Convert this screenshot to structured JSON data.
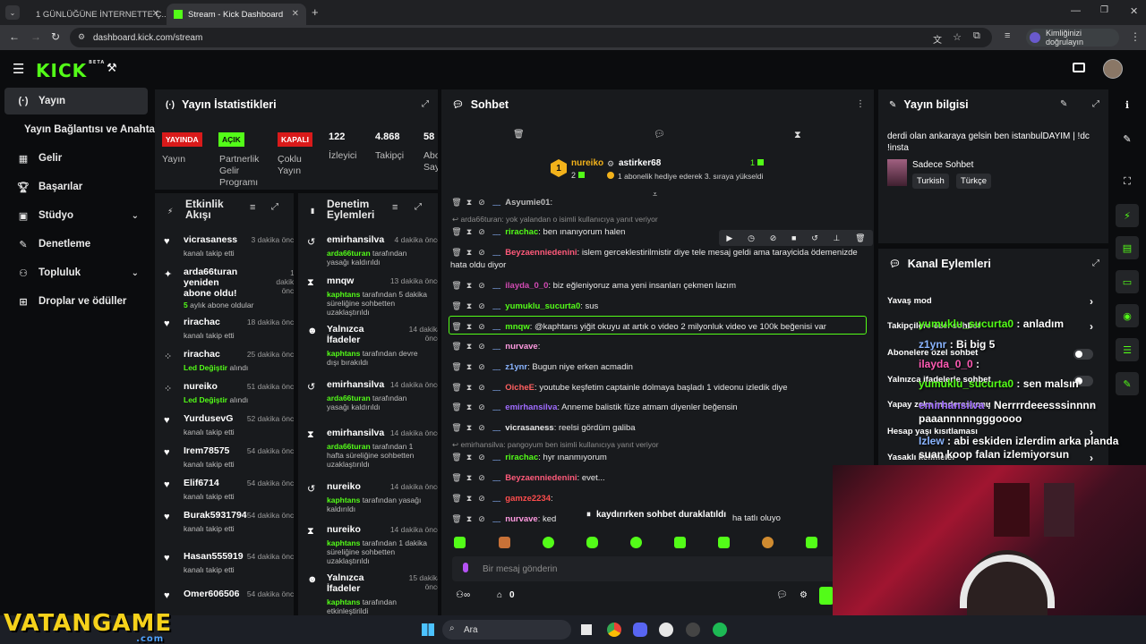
{
  "browser": {
    "tabs": [
      {
        "label": "1 GÜNLÜĞÜNE İNTERNETTE Ç..."
      },
      {
        "label": "Stream - Kick Dashboard"
      }
    ],
    "url": "dashboard.kick.com/stream",
    "verify_label": "Kimliğinizi doğrulayın"
  },
  "header": {
    "logo": "KICK",
    "logo_sup": "BETA"
  },
  "sidebar": {
    "items": [
      {
        "label": "Yayın",
        "icon": "broadcast-icon"
      },
      {
        "label": "Yayın Bağlantısı ve Anahtarı",
        "icon": ""
      },
      {
        "label": "Gelir",
        "icon": "revenue-icon"
      },
      {
        "label": "Başarılar",
        "icon": "trophy-icon"
      },
      {
        "label": "Stüdyo",
        "icon": "studio-icon"
      },
      {
        "label": "Denetleme",
        "icon": "wrench-icon"
      },
      {
        "label": "Topluluk",
        "icon": "community-icon"
      },
      {
        "label": "Droplar ve ödüller",
        "icon": "drops-icon"
      }
    ]
  },
  "stats": {
    "title": "Yayın İstatistikleri",
    "live_badge": "YAYINDA",
    "live_label": "Yayın",
    "partner_badge": "AÇIK",
    "partner_label": "Partnerlik Gelir Programı",
    "multi_badge": "KAPALI",
    "multi_label": "Çoklu Yayın",
    "viewers": "122",
    "viewers_label": "İzleyici",
    "followers": "4.868",
    "followers_label": "Takipçi",
    "subs": "58",
    "subs_label": "Abo Say"
  },
  "activity": {
    "title": "Etkinlik Akışı",
    "items": [
      {
        "name": "vicrasaness",
        "time": "3 dakika önce",
        "sub": "kanalı takip etti",
        "icon": "heart-icon"
      },
      {
        "name": "arda66turan yeniden abone oldu!",
        "time": "11 dakika önce",
        "sub_g": "5",
        "sub": " aylık abone oldular",
        "icon": "sparkle-icon"
      },
      {
        "name": "rirachac",
        "time": "18 dakika önce",
        "sub": "kanalı takip etti",
        "icon": "heart-icon"
      },
      {
        "name": "rirachac",
        "time": "25 dakika önce",
        "sub_g": "Led Değiştir",
        "sub": " alındı",
        "icon": "drops-icon"
      },
      {
        "name": "nureiko",
        "time": "51 dakika önce",
        "sub_g": "Led Değiştir",
        "sub": " alındı",
        "icon": "drops-icon"
      },
      {
        "name": "YurdusevG",
        "time": "52 dakika önce",
        "sub": "kanalı takip etti",
        "icon": "heart-icon"
      },
      {
        "name": "Irem78575",
        "time": "54 dakika önce",
        "sub": "kanalı takip etti",
        "icon": "heart-icon"
      },
      {
        "name": "Elif6714",
        "time": "54 dakika önce",
        "sub": "kanalı takip etti",
        "icon": "heart-icon"
      },
      {
        "name": "Burak5931794",
        "time": "54 dakika önce",
        "sub": "kanalı takip etti",
        "icon": "heart-icon"
      },
      {
        "name": "Hasan555919",
        "time": "54 dakika önce",
        "sub": "kanalı takip etti",
        "icon": "heart-icon"
      },
      {
        "name": "Omer606506",
        "time": "54 dakika önce",
        "sub": "",
        "icon": "heart-icon"
      }
    ]
  },
  "moderation": {
    "title": "Denetim Eylemleri",
    "items": [
      {
        "name": "emirhansilva",
        "time": "4 dakika önce",
        "sub_g": "arda66turan",
        "sub": " tarafından yasağı kaldırıldı",
        "icon": "undo-icon"
      },
      {
        "name": "mnqw",
        "time": "13 dakika önce",
        "sub_g": "kaphtans",
        "sub": " tarafından 5 dakika süreliğine sohbetten uzaklaştırıldı",
        "icon": "hourglass-icon"
      },
      {
        "name": "Yalnızca İfadeler",
        "time": "14 dakika önce",
        "sub_g": "kaphtans",
        "sub": " tarafından devre dışı bırakıldı",
        "icon": "smile-icon"
      },
      {
        "name": "emirhansilva",
        "time": "14 dakika önce",
        "sub_g": "arda66turan",
        "sub": " tarafından yasağı kaldırıldı",
        "icon": "undo-icon"
      },
      {
        "name": "emirhansilva",
        "time": "14 dakika önce",
        "sub_g": "arda66turan",
        "sub": " tarafından 1 hafta süreliğine sohbetten uzaklaştırıldı",
        "icon": "hourglass-icon"
      },
      {
        "name": "nureiko",
        "time": "14 dakika önce",
        "sub_g": "kaphtans",
        "sub": " tarafından yasağı kaldırıldı",
        "icon": "undo-icon"
      },
      {
        "name": "nureiko",
        "time": "14 dakika önce",
        "sub_g": "kaphtans",
        "sub": " tarafından 1 dakika süreliğine sohbetten uzaklaştırıldı",
        "icon": "hourglass-icon"
      },
      {
        "name": "Yalnızca İfadeler",
        "time": "15 dakika önce",
        "sub_g": "kaphtans",
        "sub": " tarafından etkinleştirildi",
        "icon": "smile-icon"
      }
    ]
  },
  "chat": {
    "title": "Sohbet",
    "pinned": {
      "user1": "nureiko",
      "user1_count": "2",
      "user2": "astirker68",
      "user2_count": "1",
      "note": "1 abonelik hediye ederek 3. sıraya yükseldi",
      "rank": "1"
    },
    "messages": [
      {
        "user": "Asyumie01",
        "color": "#bdbdbd",
        "text": ""
      },
      {
        "reply": "arda66turan: yok yalandan o isimli kullanıcıya yanıt veriyor"
      },
      {
        "user": "rirachac",
        "color": "#53fc18",
        "text": "ben ınanıyorum halen"
      },
      {
        "user": "Beyzaenniedenini",
        "color": "#ff5a7a",
        "text": "islem gerceklestirilmistir diye tele mesaj geldi ama tarayicida ödemenizde hata oldu diyor"
      },
      {
        "user": "ilayda_0_0",
        "color": "#d24ab3",
        "text": "biz eğleniyoruz ama yeni insanları çekmen lazım"
      },
      {
        "user": "yumuklu_sucurta0",
        "color": "#53fc18",
        "text": "sus"
      },
      {
        "user": "mnqw",
        "color": "#53fc18",
        "text": "@kaphtans yiğit okuyu at artık o video 2 milyonluk video ve 100k beğenisi var"
      },
      {
        "user": "nurvave",
        "color": "#ff9ae0",
        "text": ""
      },
      {
        "user": "z1ynr",
        "color": "#8ab4ff",
        "text": "Bugun niye erken acmadin"
      },
      {
        "user": "OicheE",
        "color": "#ff6060",
        "text": "youtube keşfetim captainle dolmaya başladı 1 videonu izledik diye"
      },
      {
        "user": "emirhansilva",
        "color": "#a06cff",
        "text": "Anneme balistik füze atmam diyenler beğensin"
      },
      {
        "user": "vicrasaness",
        "color": "#e8e8e8",
        "text": "reelsi gördüm galiba"
      },
      {
        "reply": "emirhansilva: pangoyum ben isimli kullanıcıya yanıt veriyor"
      },
      {
        "user": "rirachac",
        "color": "#53fc18",
        "text": "hyr ınanmıyorum"
      },
      {
        "user": "Beyzaenniedenini",
        "color": "#ff5a7a",
        "text": "evet..."
      },
      {
        "user": "gamze2234",
        "color": "#ff4d4d",
        "text": ""
      },
      {
        "user": "nurvave",
        "color": "#ff9ae0",
        "text": "ked"
      }
    ],
    "pause_label": "kaydırırken sohbet duraklatıldı",
    "trailing": "ha tatlı oluyo",
    "input_placeholder": "Bir mesaj gönderin",
    "footer_count": "0"
  },
  "info": {
    "title": "Yayın bilgisi",
    "stream_title": "derdi olan ankaraya gelsin ben istanbulDAYIM | !dc !insta",
    "category": "Sadece Sohbet",
    "tags": [
      "Turkish",
      "Türkçe"
    ]
  },
  "canal": {
    "title": "Kanal Eylemleri",
    "rows": [
      "Yavaş mod",
      "Takipçilere özel sohbet",
      "Abonelere özel sohbet",
      "Yalnızca ifadelerle sohbet",
      "Yapay zeka moderasyonu",
      "Hesap yaşı kısıtlaması",
      "Yasaklı kelimeler"
    ]
  },
  "overlay_chat": [
    {
      "user": "yumuklu_sucurta0",
      "text": " : anladım",
      "color": "#53fc18"
    },
    {
      "user": "z1ynr",
      "text": " : Bi big 5",
      "color": "#8ab4ff"
    },
    {
      "user": "ilayda_0_0",
      "text": " :",
      "color": "#ff5ab3"
    },
    {
      "user": "yumuklu_sucurta0",
      "text": " : sen malsın",
      "color": "#53fc18"
    },
    {
      "user": "emirhansilva",
      "text": " : Nerrrrdeeesssinnnn paaannnnngggoooo",
      "color": "#a06cff"
    },
    {
      "user": "Izlew",
      "text": " : abi eskiden izlerdim arka planda suan koop falan izlemiyorsun",
      "color": "#8ab4ff"
    }
  ],
  "taskbar": {
    "search": "Ara",
    "watermark": "VATANGAME",
    "watermark_sub": ".com"
  }
}
